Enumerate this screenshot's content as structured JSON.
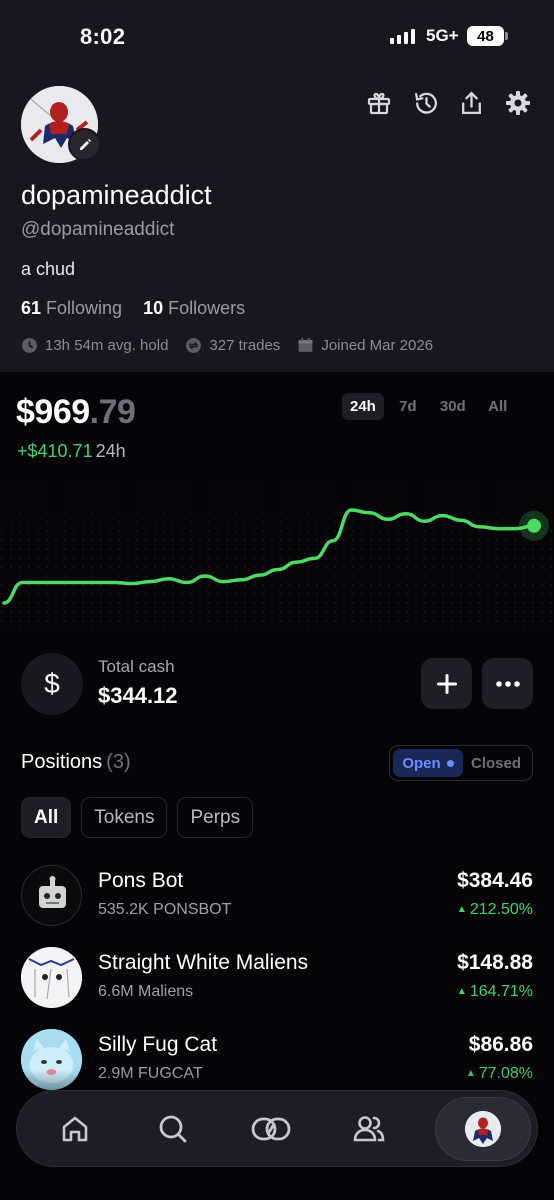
{
  "status_bar": {
    "time": "8:02",
    "network": "5G+",
    "battery": "48"
  },
  "profile": {
    "display_name": "dopamineaddict",
    "handle": "@dopamineaddict",
    "bio": "a chud",
    "following_count": "61",
    "following_label": "Following",
    "followers_count": "10",
    "followers_label": "Followers",
    "avg_hold": "13h 54m avg. hold",
    "trades": "327 trades",
    "joined": "Joined Mar 2026"
  },
  "header_icons": [
    "gift-icon",
    "history-icon",
    "share-icon",
    "settings-icon"
  ],
  "portfolio": {
    "value_whole": "$969",
    "value_cents": ".79",
    "change_amount": "+$410.71",
    "change_period": "24h",
    "ranges": [
      "24h",
      "7d",
      "30d",
      "All"
    ],
    "active_range": "24h"
  },
  "chart_data": {
    "type": "line",
    "y": [
      0.0,
      0.22,
      0.22,
      0.22,
      0.22,
      0.22,
      0.22,
      0.21,
      0.23,
      0.26,
      0.22,
      0.29,
      0.23,
      0.25,
      0.3,
      0.36,
      0.44,
      0.48,
      0.67,
      1.0,
      0.97,
      0.9,
      0.96,
      0.88,
      0.94,
      0.89,
      0.82,
      0.8,
      0.8,
      0.83
    ],
    "color": "#4cd964"
  },
  "cash": {
    "label": "Total cash",
    "value": "$344.12",
    "symbol": "$"
  },
  "positions": {
    "title": "Positions",
    "count": "(3)",
    "toggle_open": "Open",
    "toggle_closed": "Closed",
    "filters": [
      "All",
      "Tokens",
      "Perps"
    ],
    "items": [
      {
        "name": "Pons Bot",
        "amount": "535.2K PONSBOT",
        "value": "$384.46",
        "change": "212.50%"
      },
      {
        "name": "Straight White Maliens",
        "amount": "6.6M Maliens",
        "value": "$148.88",
        "change": "164.71%"
      },
      {
        "name": "Silly Fug Cat",
        "amount": "2.9M FUGCAT",
        "value": "$86.86",
        "change": "77.08%"
      }
    ]
  },
  "colors": {
    "accent_green": "#3ed36e",
    "accent_blue": "#6f8cff",
    "header_bg": "#17171d",
    "page_bg": "#050507"
  },
  "nav_icons": [
    "home-icon",
    "search-icon",
    "swap-icon",
    "people-icon",
    "profile-avatar"
  ]
}
